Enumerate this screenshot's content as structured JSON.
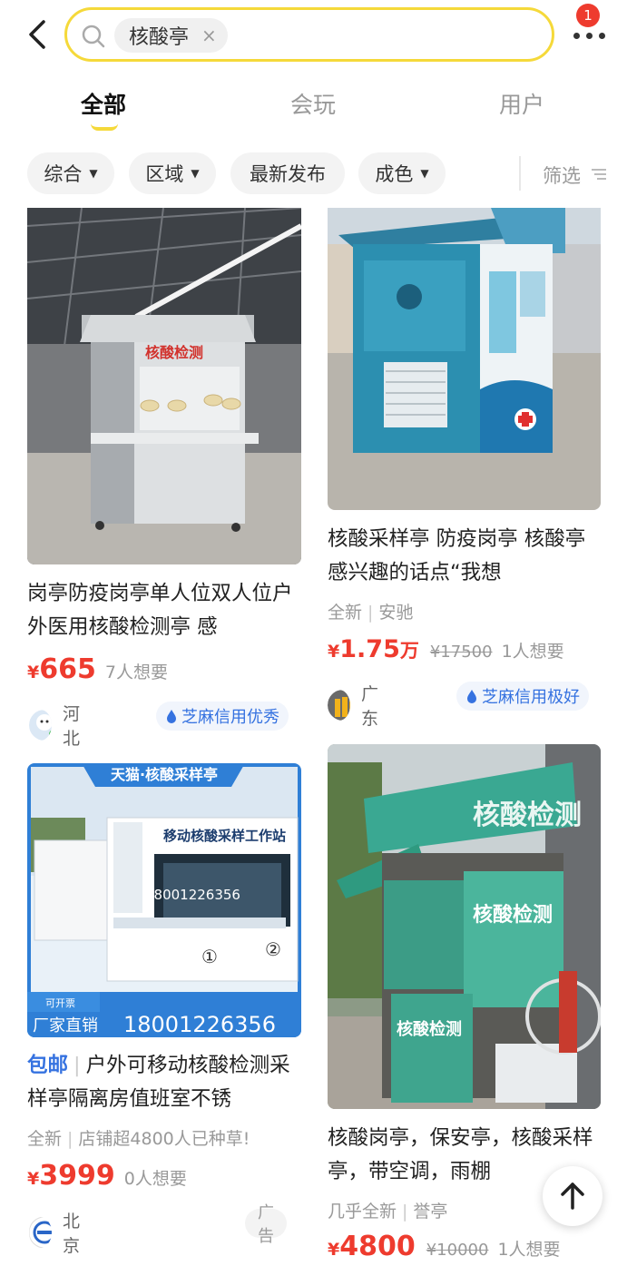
{
  "search": {
    "query": "核酸亭",
    "clear_label": "×"
  },
  "header": {
    "badge_count": "1",
    "more_icon": "more-dots-icon",
    "back_icon": "chevron-left-icon"
  },
  "tabs": [
    {
      "label": "全部",
      "active": true
    },
    {
      "label": "会玩",
      "active": false
    },
    {
      "label": "用户",
      "active": false
    }
  ],
  "filters": [
    {
      "label": "综合",
      "dropdown": true
    },
    {
      "label": "区域",
      "dropdown": true
    },
    {
      "label": "最新发布",
      "dropdown": false
    },
    {
      "label": "成色",
      "dropdown": true
    }
  ],
  "filter_button": "筛选",
  "items": [
    {
      "title": "岗亭防疫岗亭单人位双人位户外医用核酸检测亭 感",
      "price_symbol": "¥",
      "price": "665",
      "want": "7人想要",
      "region": "河北",
      "credit": "芝麻信用优秀"
    },
    {
      "title": "核酸采样亭  防疫岗亭 核酸亭 感兴趣的话点“我想",
      "condition": "全新",
      "brand": "安驰",
      "price_symbol": "¥",
      "price": "1.75",
      "price_unit": "万",
      "original_price": "¥17500",
      "want": "1人想要",
      "region": "广东",
      "credit": "芝麻信用极好"
    },
    {
      "shipping": "包邮",
      "title": "户外可移动核酸检测采样亭隔离房值班室不锈",
      "condition": "全新",
      "note": "店铺超4800人已种草!",
      "price_symbol": "¥",
      "price": "3999",
      "want": "0人想要",
      "region": "北京",
      "ad": "广告",
      "image_text": {
        "banner": "天猫·核酸采样亭",
        "station": "移动核酸采样工作站",
        "phone": "18001226356",
        "invoice": "可开票",
        "direct": "厂家直销",
        "phone_big": "18001226356",
        "num1": "①",
        "num2": "②"
      }
    },
    {
      "title": "核酸岗亭，保安亭，核酸采样亭，带空调，雨棚",
      "condition": "几乎全新",
      "brand": "誉亭",
      "price_symbol": "¥",
      "price": "4800",
      "original_price": "¥10000",
      "want": "1人想要",
      "image_text": {
        "sign": "核酸检测",
        "panel": "核酸检测",
        "panel_small": "核酸检测"
      }
    }
  ],
  "image1_text": "核酸检测",
  "colors": {
    "accent_yellow": "#f5d93a",
    "price_red": "#ee3b2e",
    "credit_blue": "#3572e0"
  }
}
